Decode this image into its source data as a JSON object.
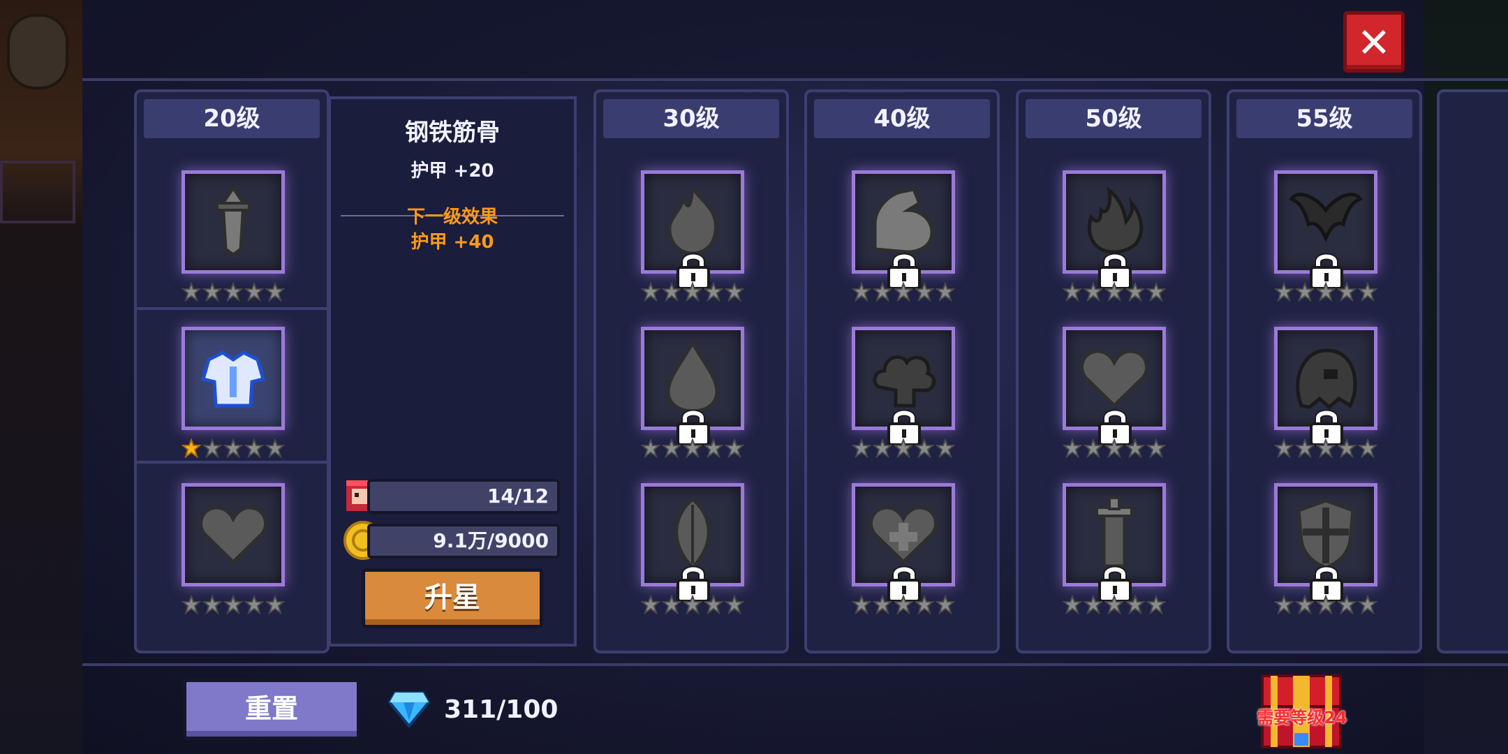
{
  "columns": [
    {
      "title": "20级",
      "items": [
        {
          "name": "sword-talent",
          "stars": 0,
          "locked": false,
          "active": false
        },
        {
          "name": "armor-talent",
          "stars": 1,
          "locked": false,
          "active": true
        },
        {
          "name": "heart-talent",
          "stars": 0,
          "locked": false,
          "active": false
        }
      ]
    },
    {
      "title": "30级",
      "items": [
        {
          "name": "flame-talent",
          "stars": 0,
          "locked": true
        },
        {
          "name": "drop-talent",
          "stars": 0,
          "locked": true
        },
        {
          "name": "leaf-talent",
          "stars": 0,
          "locked": true
        }
      ]
    },
    {
      "title": "40级",
      "items": [
        {
          "name": "muscle-talent",
          "stars": 0,
          "locked": true
        },
        {
          "name": "cloud-talent",
          "stars": 0,
          "locked": true
        },
        {
          "name": "heart-plus-talent",
          "stars": 0,
          "locked": true
        }
      ]
    },
    {
      "title": "50级",
      "items": [
        {
          "name": "fire-talent",
          "stars": 0,
          "locked": true
        },
        {
          "name": "heart-talent",
          "stars": 0,
          "locked": true
        },
        {
          "name": "pillar-talent",
          "stars": 0,
          "locked": true
        }
      ]
    },
    {
      "title": "55级",
      "items": [
        {
          "name": "wing-talent",
          "stars": 0,
          "locked": true
        },
        {
          "name": "ghost-talent",
          "stars": 0,
          "locked": true
        },
        {
          "name": "shield-talent",
          "stars": 0,
          "locked": true
        }
      ]
    }
  ],
  "detail": {
    "title": "钢铁筋骨",
    "current": "护甲 +20",
    "next_label": "下一级效果",
    "next_value": "护甲 +40",
    "fragments": "14/12",
    "gold": "9.1万/9000",
    "upgrade_label": "升星"
  },
  "footer": {
    "reset_label": "重置",
    "gems": "311/100",
    "chest_label": "需要等级24"
  },
  "colors": {
    "accent_gold": "#ff9a1a",
    "slot_glow": "#9b7ad8",
    "close_red": "#d0262c"
  }
}
